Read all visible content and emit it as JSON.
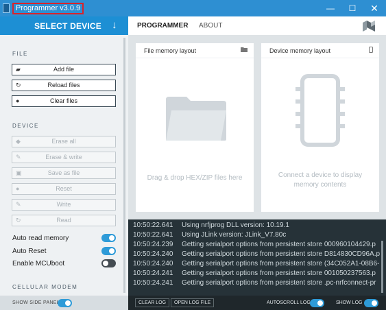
{
  "window": {
    "title": "Programmer v3.0.9",
    "minimize": "—",
    "maximize": "☐",
    "close": "✕"
  },
  "device_selector": {
    "label": "SELECT DEVICE",
    "arrow": "↓"
  },
  "nav": {
    "tabs": [
      "PROGRAMMER",
      "ABOUT"
    ],
    "active_tab": "PROGRAMMER"
  },
  "sidebar": {
    "file_section": {
      "title": "FILE",
      "buttons": [
        {
          "label": "Add file",
          "icon": "folder-icon",
          "glyph": "▰",
          "enabled": true
        },
        {
          "label": "Reload files",
          "icon": "reload-icon",
          "glyph": "↻",
          "enabled": true
        },
        {
          "label": "Clear files",
          "icon": "clear-icon",
          "glyph": "●",
          "enabled": true
        }
      ]
    },
    "device_section": {
      "title": "DEVICE",
      "buttons": [
        {
          "label": "Erase all",
          "icon": "eraser-icon",
          "glyph": "◆",
          "enabled": false
        },
        {
          "label": "Erase & write",
          "icon": "pencil-icon",
          "glyph": "✎",
          "enabled": false
        },
        {
          "label": "Save as file",
          "icon": "save-icon",
          "glyph": "▣",
          "enabled": false
        },
        {
          "label": "Reset",
          "icon": "reset-icon",
          "glyph": "●",
          "enabled": false
        },
        {
          "label": "Write",
          "icon": "pencil-icon",
          "glyph": "✎",
          "enabled": false
        },
        {
          "label": "Read",
          "icon": "read-icon",
          "glyph": "↻",
          "enabled": false
        }
      ]
    },
    "toggles": [
      {
        "label": "Auto read memory",
        "on": true
      },
      {
        "label": "Auto Reset",
        "on": true
      },
      {
        "label": "Enable MCUboot",
        "on": false
      }
    ],
    "cellular_section": {
      "title": "CELLULAR MODEM"
    }
  },
  "footer_left": {
    "show_side_panel_label": "SHOW SIDE PANEL",
    "show_side_panel_on": true
  },
  "file_pane": {
    "title": "File memory layout",
    "message": "Drag & drop HEX/ZIP files here"
  },
  "device_pane": {
    "title": "Device memory layout",
    "message_line1": "Connect a device to display",
    "message_line2": "memory contents"
  },
  "log": {
    "lines": [
      {
        "time": "10:50:22.641",
        "text": "Using nrfjprog DLL version: 10.19.1"
      },
      {
        "time": "10:50:22.641",
        "text": "Using JLink version: JLink_V7.80c"
      },
      {
        "time": "10:50:24.239",
        "text": "Getting serialport options from persistent store 000960104429.p"
      },
      {
        "time": "10:50:24.240",
        "text": "Getting serialport options from persistent store D814830CD96A.p"
      },
      {
        "time": "10:50:24.240",
        "text": "Getting serialport options from persistent store (34C052A1-08B6-"
      },
      {
        "time": "10:50:24.241",
        "text": "Getting serialport options from persistent store 001050237563.p"
      },
      {
        "time": "10:50:24.241",
        "text": "Getting serialport options from persistent store .pc-nrfconnect-pr"
      }
    ]
  },
  "footer_right": {
    "clear_log": "CLEAR LOG",
    "open_log_file": "OPEN LOG FILE",
    "autoscroll_label": "AUTOSCROLL LOG",
    "autoscroll_on": true,
    "show_log_label": "SHOW LOG",
    "show_log_on": true
  },
  "colors": {
    "accent": "#1d8fd4",
    "titlebar": "#2e8fd2",
    "log_bg": "#263238",
    "toggle_on": "#2e9bd8",
    "toggle_off": "#444c52"
  }
}
